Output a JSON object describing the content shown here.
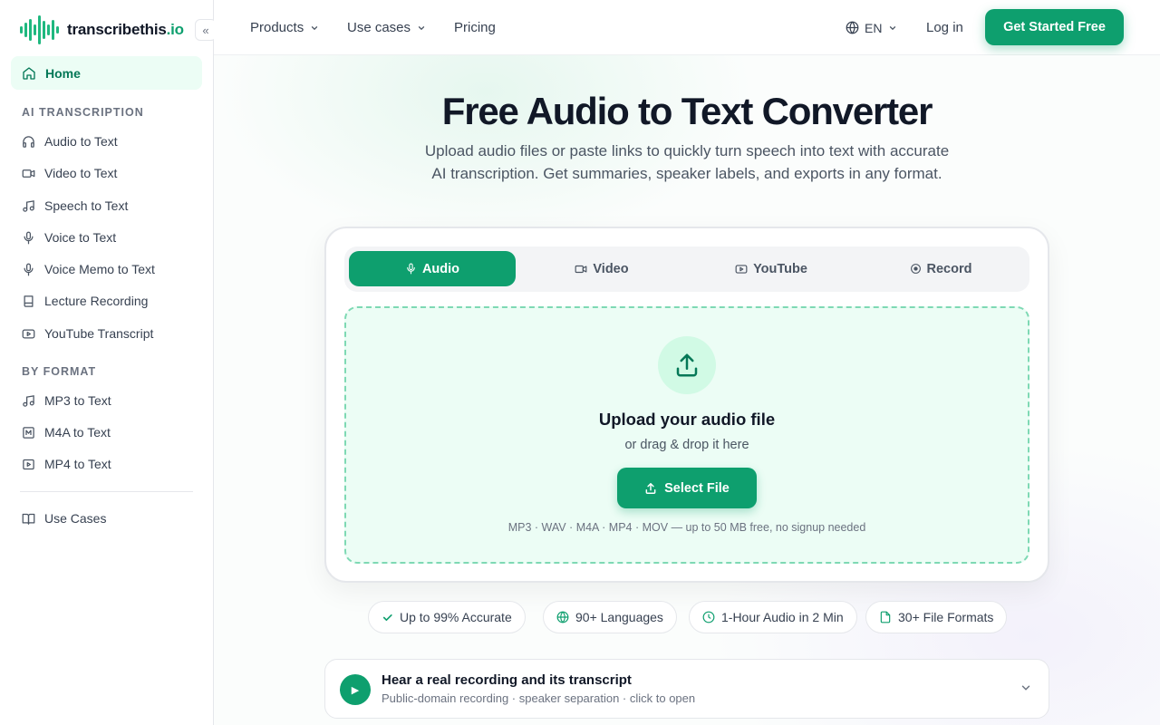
{
  "brand": {
    "name": "transcribethis",
    "tld": ".io"
  },
  "sidebar": {
    "home": "Home",
    "sections": [
      {
        "title": "AI TRANSCRIPTION",
        "items": [
          {
            "label": "Audio to Text",
            "icon": "headphones-icon"
          },
          {
            "label": "Video to Text",
            "icon": "video-icon"
          },
          {
            "label": "Speech to Text",
            "icon": "music-note-icon"
          },
          {
            "label": "Voice to Text",
            "icon": "microphone-icon"
          },
          {
            "label": "Voice Memo to Text",
            "icon": "microphone-icon"
          },
          {
            "label": "Lecture Recording",
            "icon": "book-icon"
          },
          {
            "label": "YouTube Transcript",
            "icon": "youtube-icon"
          }
        ]
      },
      {
        "title": "BY FORMAT",
        "items": [
          {
            "label": "MP3 to Text",
            "icon": "music-note-icon"
          },
          {
            "label": "M4A to Text",
            "icon": "file-m-icon"
          },
          {
            "label": "MP4 to Text",
            "icon": "play-box-icon"
          }
        ]
      }
    ],
    "use_cases": "Use Cases"
  },
  "topnav": {
    "products": "Products",
    "use_cases": "Use cases",
    "pricing": "Pricing",
    "language": "EN",
    "login": "Log in",
    "cta": "Get Started Free"
  },
  "hero": {
    "title": "Free Audio to Text Converter",
    "subtitle": "Upload audio files or paste links to quickly turn speech into text with accurate AI transcription. Get summaries, speaker labels, and exports in any format."
  },
  "uploader": {
    "tabs": [
      "Audio",
      "Video",
      "YouTube",
      "Record"
    ],
    "active_tab": "Audio",
    "title": "Upload your audio file",
    "subtitle": "or drag & drop it here",
    "button": "Select File",
    "note": "MP3 · WAV · M4A · MP4 · MOV — up to 50 MB free, no signup needed"
  },
  "badges": [
    "Up to 99% Accurate",
    "90+ Languages",
    "1-Hour Audio in 2 Min",
    "30+ File Formats"
  ],
  "sample": {
    "title": "Hear a real recording and its transcript",
    "subtitle": "Public-domain recording · speaker separation · click to open"
  },
  "colors": {
    "accent": "#0e9f6e",
    "accent_light": "#ecfdf5"
  }
}
